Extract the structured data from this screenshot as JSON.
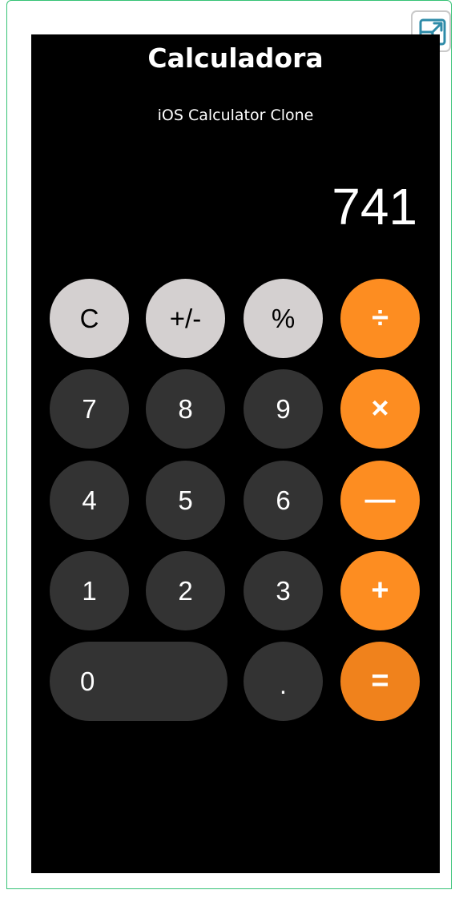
{
  "app": {
    "title": "Calculadora",
    "subtitle": "iOS Calculator Clone"
  },
  "display": {
    "value": "741"
  },
  "keys": {
    "clear": "C",
    "sign": "+/-",
    "percent": "%",
    "divide": "÷",
    "seven": "7",
    "eight": "8",
    "nine": "9",
    "multiply": "×",
    "four": "4",
    "five": "5",
    "six": "6",
    "subtract": "—",
    "one": "1",
    "two": "2",
    "three": "3",
    "add": "+",
    "zero": "0",
    "decimal": ".",
    "equals": "="
  },
  "icons": {
    "expand": "expand-icon"
  },
  "colors": {
    "background": "#000000",
    "function_key": "#d4d0d0",
    "number_key": "#333333",
    "operator_key": "#fd8d21",
    "frame_border": "#35c275"
  }
}
